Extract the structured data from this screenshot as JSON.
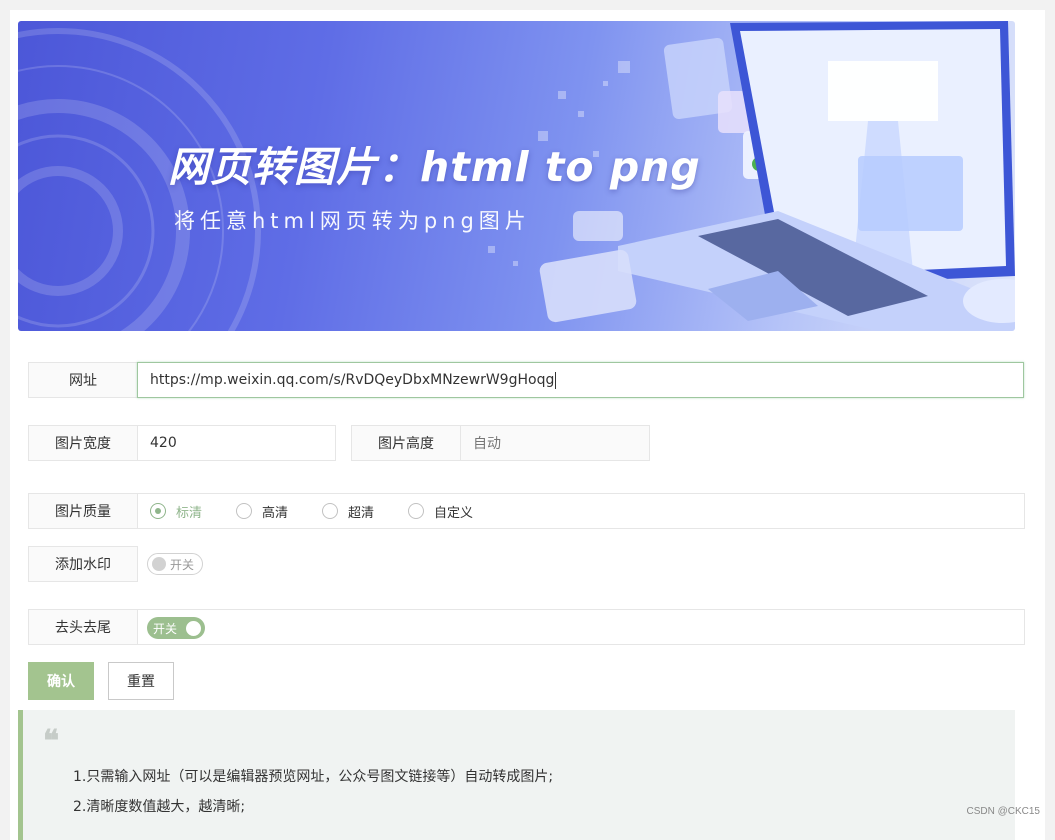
{
  "banner": {
    "title": "网页转图片：html  to  png",
    "subtitle": "将任意html网页转为png图片"
  },
  "form": {
    "url": {
      "label": "网址",
      "value": "https://mp.weixin.qq.com/s/RvDQeyDbxMNzewrW9gHoqg"
    },
    "width": {
      "label": "图片宽度",
      "value": "420"
    },
    "height": {
      "label": "图片高度",
      "placeholder": "自动"
    },
    "quality": {
      "label": "图片质量",
      "options": [
        "标清",
        "高清",
        "超清",
        "自定义"
      ],
      "selected": "标清"
    },
    "watermark": {
      "label": "添加水印",
      "switch_text": "开关",
      "on": false
    },
    "trim": {
      "label": "去头去尾",
      "switch_text": "开关",
      "on": true
    }
  },
  "buttons": {
    "confirm": "确认",
    "reset": "重置"
  },
  "tips": {
    "mark": "❝",
    "items": [
      "1.只需输入网址（可以是编辑器预览网址，公众号图文链接等）自动转成图片;",
      "2.清晰度数值越大，越清晰;"
    ]
  },
  "footer": {
    "watermark": "CSDN @CKC15"
  },
  "colors": {
    "accent": "#a3c48f",
    "banner_start": "#4c57d8",
    "banner_end": "#dfe6fb"
  }
}
